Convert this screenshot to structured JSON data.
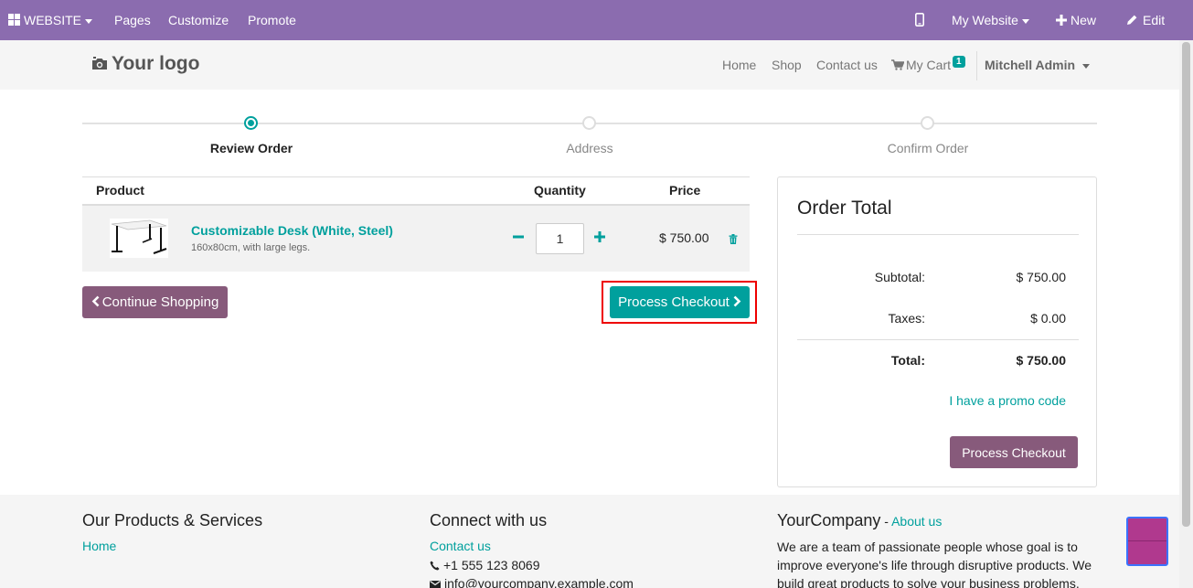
{
  "topbar": {
    "website_menu": "WEBSITE",
    "pages": "Pages",
    "customize": "Customize",
    "promote": "Promote",
    "my_website": "My Website",
    "new": "New",
    "edit": "Edit"
  },
  "header": {
    "logo": "Your logo",
    "nav": {
      "home": "Home",
      "shop": "Shop",
      "contact": "Contact us",
      "cart": "My Cart",
      "cart_count": "1",
      "user": "Mitchell Admin"
    }
  },
  "wizard": {
    "steps": [
      {
        "label": "Review Order",
        "active": true
      },
      {
        "label": "Address",
        "active": false
      },
      {
        "label": "Confirm Order",
        "active": false
      }
    ]
  },
  "cart": {
    "headers": {
      "product": "Product",
      "quantity": "Quantity",
      "price": "Price"
    },
    "items": [
      {
        "name": "Customizable Desk (White, Steel)",
        "description": "160x80cm, with large legs.",
        "quantity": "1",
        "price": "$ 750.00"
      }
    ],
    "continue_label": "Continue Shopping",
    "checkout_label": "Process Checkout"
  },
  "order_total": {
    "title": "Order Total",
    "subtotal_label": "Subtotal:",
    "subtotal_value": "$ 750.00",
    "taxes_label": "Taxes:",
    "taxes_value": "$ 0.00",
    "total_label": "Total:",
    "total_value": "$ 750.00",
    "promo_label": "I have a promo code",
    "checkout_label": "Process Checkout"
  },
  "footer": {
    "products_title": "Our Products & Services",
    "products_link": "Home",
    "connect_title": "Connect with us",
    "contact_link": "Contact us",
    "phone": "+1 555 123 8069",
    "email": "info@yourcompany.example.com",
    "company_name": "YourCompany",
    "company_sep": " - ",
    "about_link": "About us",
    "about_text": "We are a team of passionate people whose goal is to improve everyone's life through disruptive products. We build great products to solve your business problems."
  },
  "colors": {
    "topbar": "#8b6caf",
    "primary_teal": "#00a09d",
    "secondary_purple": "#875a7b",
    "highlight": "#ee0000"
  }
}
